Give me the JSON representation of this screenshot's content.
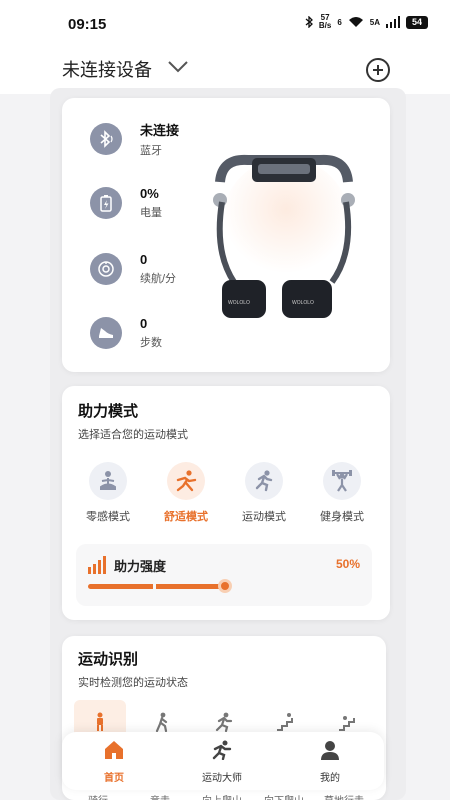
{
  "status_bar": {
    "time": "09:15",
    "net_speed_value": "57",
    "net_speed_unit": "B/s",
    "signal_6": "6",
    "signal_5a": "5A",
    "battery": "54"
  },
  "header": {
    "device_title": "未连接设备"
  },
  "device": {
    "stats": [
      {
        "value": "未连接",
        "label": "蓝牙",
        "icon": "bluetooth-icon"
      },
      {
        "value": "0%",
        "label": "电量",
        "icon": "battery-icon"
      },
      {
        "value": "0",
        "label": "续航/分",
        "icon": "timer-icon"
      },
      {
        "value": "0",
        "label": "步数",
        "icon": "shoe-icon"
      }
    ],
    "image_brand": "WOLOLO"
  },
  "assist": {
    "title": "助力模式",
    "subtitle": "选择适合您的运动模式",
    "modes": [
      {
        "label": "零感模式",
        "icon": "meditation-icon",
        "active": false
      },
      {
        "label": "舒适模式",
        "icon": "stretch-icon",
        "active": true
      },
      {
        "label": "运动模式",
        "icon": "running-icon",
        "active": false
      },
      {
        "label": "健身模式",
        "icon": "weightlifting-icon",
        "active": false
      }
    ],
    "intensity_label": "助力强度",
    "intensity_value": "50%",
    "intensity_level": 0.5
  },
  "motion": {
    "title": "运动识别",
    "subtitle": "实时检测您的运动状态",
    "strip_labels": [
      "骑行",
      "竞走",
      "向上爬山",
      "向下爬山",
      "草地行走"
    ]
  },
  "tabs": [
    {
      "label": "首页",
      "icon": "home-icon",
      "active": true
    },
    {
      "label": "运动大师",
      "icon": "sport-icon",
      "active": false
    },
    {
      "label": "我的",
      "icon": "user-icon",
      "active": false
    }
  ],
  "colors": {
    "accent": "#e8712c",
    "icon_bg": "#8c93a8"
  }
}
